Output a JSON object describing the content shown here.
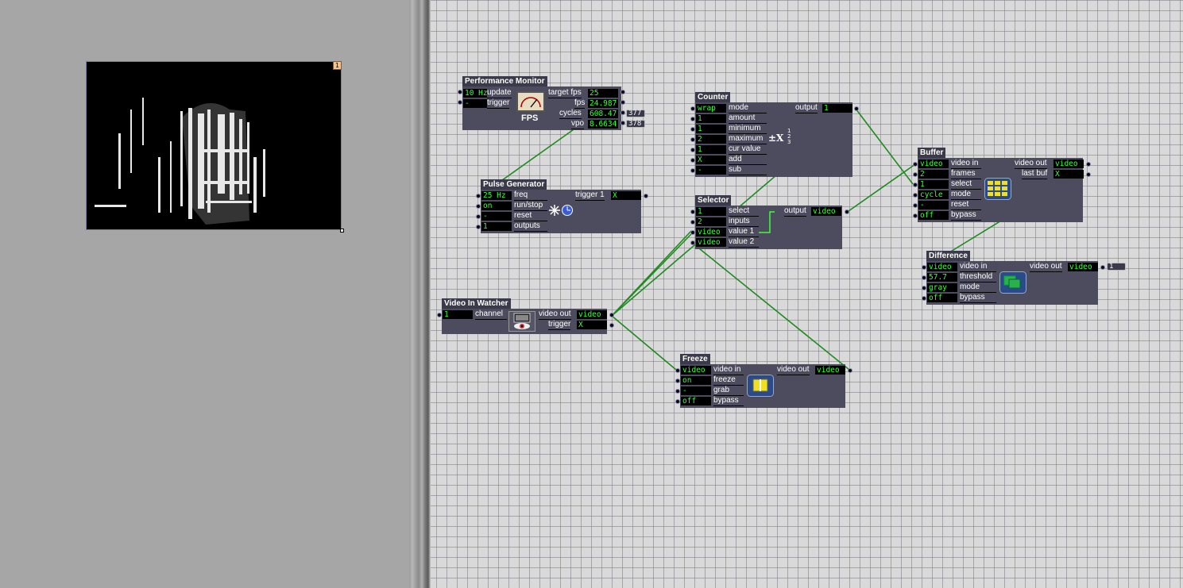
{
  "stage": {
    "badge": "1"
  },
  "performance_monitor": {
    "title": "Performance Monitor",
    "inputs": [
      {
        "value": "10 Hz",
        "label": "update"
      },
      {
        "value": "-",
        "label": "trigger"
      }
    ],
    "outputs": [
      {
        "label": "target fps",
        "value": "25"
      },
      {
        "label": "fps",
        "value": "24.987"
      },
      {
        "label": "cycles",
        "value": "608.47"
      },
      {
        "label": "vpo",
        "value": "8.6634"
      }
    ],
    "icon_text": "FPS",
    "ext_values": [
      "377",
      "378"
    ]
  },
  "pulse_generator": {
    "title": "Pulse Generator",
    "inputs": [
      {
        "value": "25 Hz",
        "label": "freq"
      },
      {
        "value": "on",
        "label": "run/stop"
      },
      {
        "value": "-",
        "label": "reset"
      },
      {
        "value": "1",
        "label": "outputs"
      }
    ],
    "outputs": [
      {
        "label": "trigger 1",
        "value": "X"
      }
    ]
  },
  "counter": {
    "title": "Counter",
    "inputs": [
      {
        "value": "wrap",
        "label": "mode"
      },
      {
        "value": "1",
        "label": "amount"
      },
      {
        "value": "1",
        "label": "minimum"
      },
      {
        "value": "2",
        "label": "maximum"
      },
      {
        "value": "1",
        "label": "cur value"
      },
      {
        "value": "X",
        "label": "add"
      },
      {
        "value": "-",
        "label": "sub"
      }
    ],
    "outputs": [
      {
        "label": "output",
        "value": "1"
      }
    ],
    "icon_text": "±X"
  },
  "selector": {
    "title": "Selector",
    "inputs": [
      {
        "value": "1",
        "label": "select"
      },
      {
        "value": "2",
        "label": "inputs"
      },
      {
        "value": "video",
        "label": "value 1"
      },
      {
        "value": "video",
        "label": "value 2"
      }
    ],
    "outputs": [
      {
        "label": "output",
        "value": "video"
      }
    ]
  },
  "buffer": {
    "title": "Buffer",
    "inputs": [
      {
        "value": "video",
        "label": "video in"
      },
      {
        "value": "2",
        "label": "frames"
      },
      {
        "value": "1",
        "label": "select"
      },
      {
        "value": "cycle",
        "label": "mode"
      },
      {
        "value": "-",
        "label": "reset"
      },
      {
        "value": "off",
        "label": "bypass"
      }
    ],
    "outputs": [
      {
        "label": "video out",
        "value": "video"
      },
      {
        "label": "last buf",
        "value": "X"
      }
    ]
  },
  "difference": {
    "title": "Difference",
    "inputs": [
      {
        "value": "video",
        "label": "video in"
      },
      {
        "value": "57.7",
        "label": "threshold"
      },
      {
        "value": "gray",
        "label": "mode"
      },
      {
        "value": "off",
        "label": "bypass"
      }
    ],
    "outputs": [
      {
        "label": "video out",
        "value": "video"
      }
    ],
    "ext_values": [
      "1"
    ]
  },
  "video_in_watcher": {
    "title": "Video In Watcher",
    "inputs": [
      {
        "value": "1",
        "label": "channel"
      }
    ],
    "outputs": [
      {
        "label": "video out",
        "value": "video"
      },
      {
        "label": "trigger",
        "value": "X"
      }
    ]
  },
  "freeze": {
    "title": "Freeze",
    "inputs": [
      {
        "value": "video",
        "label": "video in"
      },
      {
        "value": "on",
        "label": "freeze"
      },
      {
        "value": "-",
        "label": "grab"
      },
      {
        "value": "off",
        "label": "bypass"
      }
    ],
    "outputs": [
      {
        "label": "video out",
        "value": "video"
      }
    ]
  },
  "colors": {
    "wire": "#1f8a1f",
    "value_text": "#3cff3c",
    "actor_body": "#4c4c5e"
  }
}
